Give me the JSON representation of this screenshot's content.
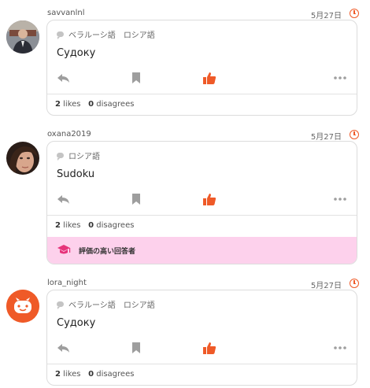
{
  "colors": {
    "accent": "#ef5a28",
    "badge_bg": "#fdd1ec",
    "icon_gray": "#9e9e9e"
  },
  "posts": [
    {
      "username": "savvanlnl",
      "date": "5月27日",
      "tags": [
        "ベラルーシ語",
        "ロシア語"
      ],
      "message": "Судоку",
      "likes_count": "2",
      "likes_label": "likes",
      "disagrees_count": "0",
      "disagrees_label": "disagrees"
    },
    {
      "username": "oxana2019",
      "date": "5月27日",
      "tags": [
        "ロシア語"
      ],
      "message": "Sudoku",
      "likes_count": "2",
      "likes_label": "likes",
      "disagrees_count": "0",
      "disagrees_label": "disagrees",
      "badge": "評価の高い回答者"
    },
    {
      "username": "lora_night",
      "date": "5月27日",
      "tags": [
        "ベラルーシ語",
        "ロシア語"
      ],
      "message": "Судоку",
      "likes_count": "2",
      "likes_label": "likes",
      "disagrees_count": "0",
      "disagrees_label": "disagrees"
    }
  ]
}
